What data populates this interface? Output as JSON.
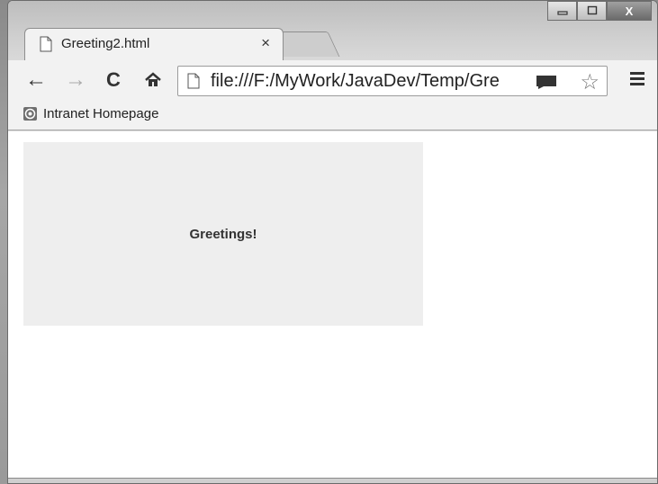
{
  "tab": {
    "title": "Greeting2.html",
    "close": "×"
  },
  "window_controls": {
    "minimize": "▭",
    "maximize": "□",
    "close": "X"
  },
  "toolbar": {
    "back": "←",
    "forward": "→",
    "reload": "C",
    "home": "⌂",
    "url": "file:///F:/MyWork/JavaDev/Temp/Gre",
    "star": "☆"
  },
  "bookmarks": {
    "items": [
      {
        "label": "Intranet Homepage"
      }
    ]
  },
  "page": {
    "greeting": "Greetings!"
  },
  "colors": {
    "content_bg": "#ffffff",
    "greet_box_bg": "#eeeeee",
    "chrome_bg": "#f2f2f2"
  }
}
